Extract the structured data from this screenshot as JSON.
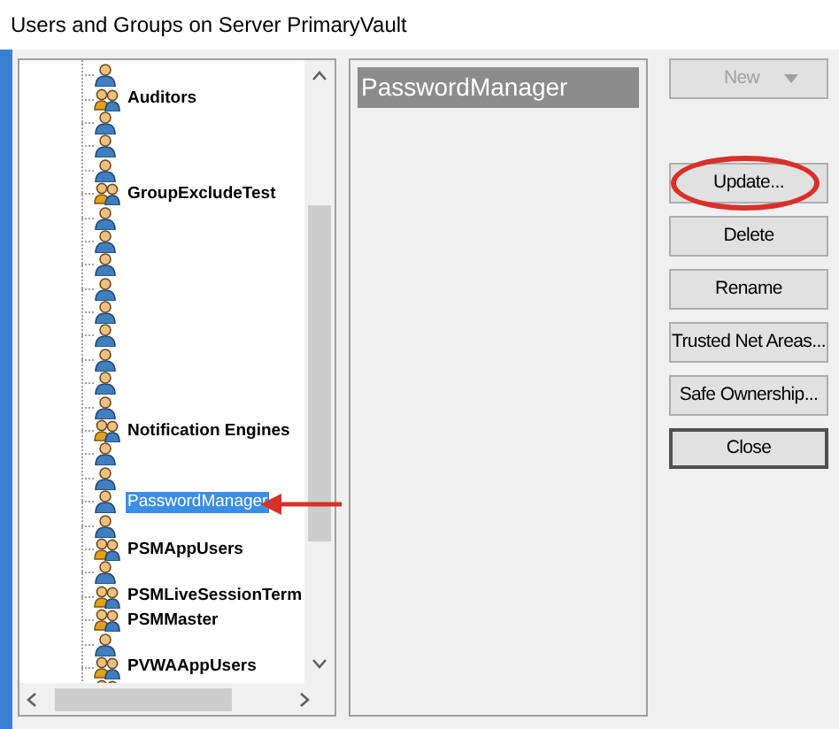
{
  "window": {
    "title": "Users and Groups on Server PrimaryVault"
  },
  "tree": {
    "items": [
      {
        "kind": "user",
        "selected": false
      },
      {
        "kind": "group",
        "label": "Auditors",
        "selected": false
      },
      {
        "kind": "user",
        "selected": false
      },
      {
        "kind": "user",
        "selected": false
      },
      {
        "kind": "user",
        "selected": false
      },
      {
        "kind": "group",
        "label": "GroupExcludeTest",
        "selected": false
      },
      {
        "kind": "user",
        "selected": false
      },
      {
        "kind": "user",
        "selected": false
      },
      {
        "kind": "user",
        "selected": false
      },
      {
        "kind": "user",
        "selected": false
      },
      {
        "kind": "user",
        "selected": false
      },
      {
        "kind": "user",
        "selected": false
      },
      {
        "kind": "user",
        "selected": false
      },
      {
        "kind": "user",
        "selected": false
      },
      {
        "kind": "user",
        "selected": false
      },
      {
        "kind": "group",
        "label": "Notification Engines",
        "selected": false
      },
      {
        "kind": "user",
        "selected": false
      },
      {
        "kind": "user",
        "selected": false
      },
      {
        "kind": "user",
        "label": "PasswordManager",
        "selected": true
      },
      {
        "kind": "user",
        "selected": false
      },
      {
        "kind": "group",
        "label": "PSMAppUsers",
        "selected": false
      },
      {
        "kind": "user",
        "selected": false
      },
      {
        "kind": "group",
        "label": "PSMLiveSessionTerm",
        "selected": false
      },
      {
        "kind": "group",
        "label": "PSMMaster",
        "selected": false
      },
      {
        "kind": "user",
        "selected": false
      },
      {
        "kind": "group",
        "label": "PVWAAppUsers",
        "selected": false
      },
      {
        "kind": "group",
        "selected": false
      }
    ]
  },
  "details": {
    "items": [
      {
        "label": "PasswordManager",
        "selected": true
      }
    ]
  },
  "buttons": [
    {
      "label": "New",
      "kind": "dropdown",
      "disabled": true,
      "highlighted": false,
      "default": false
    },
    {
      "label": "Update...",
      "kind": "button",
      "disabled": false,
      "highlighted": true,
      "default": false
    },
    {
      "label": "Delete",
      "kind": "button",
      "disabled": false,
      "highlighted": false,
      "default": false
    },
    {
      "label": "Rename",
      "kind": "button",
      "disabled": false,
      "highlighted": false,
      "default": false
    },
    {
      "label": "Trusted Net Areas...",
      "kind": "button",
      "disabled": false,
      "highlighted": false,
      "default": false
    },
    {
      "label": "Safe Ownership...",
      "kind": "button",
      "disabled": false,
      "highlighted": false,
      "default": false
    },
    {
      "label": "Close",
      "kind": "button",
      "disabled": false,
      "highlighted": false,
      "default": true
    }
  ]
}
